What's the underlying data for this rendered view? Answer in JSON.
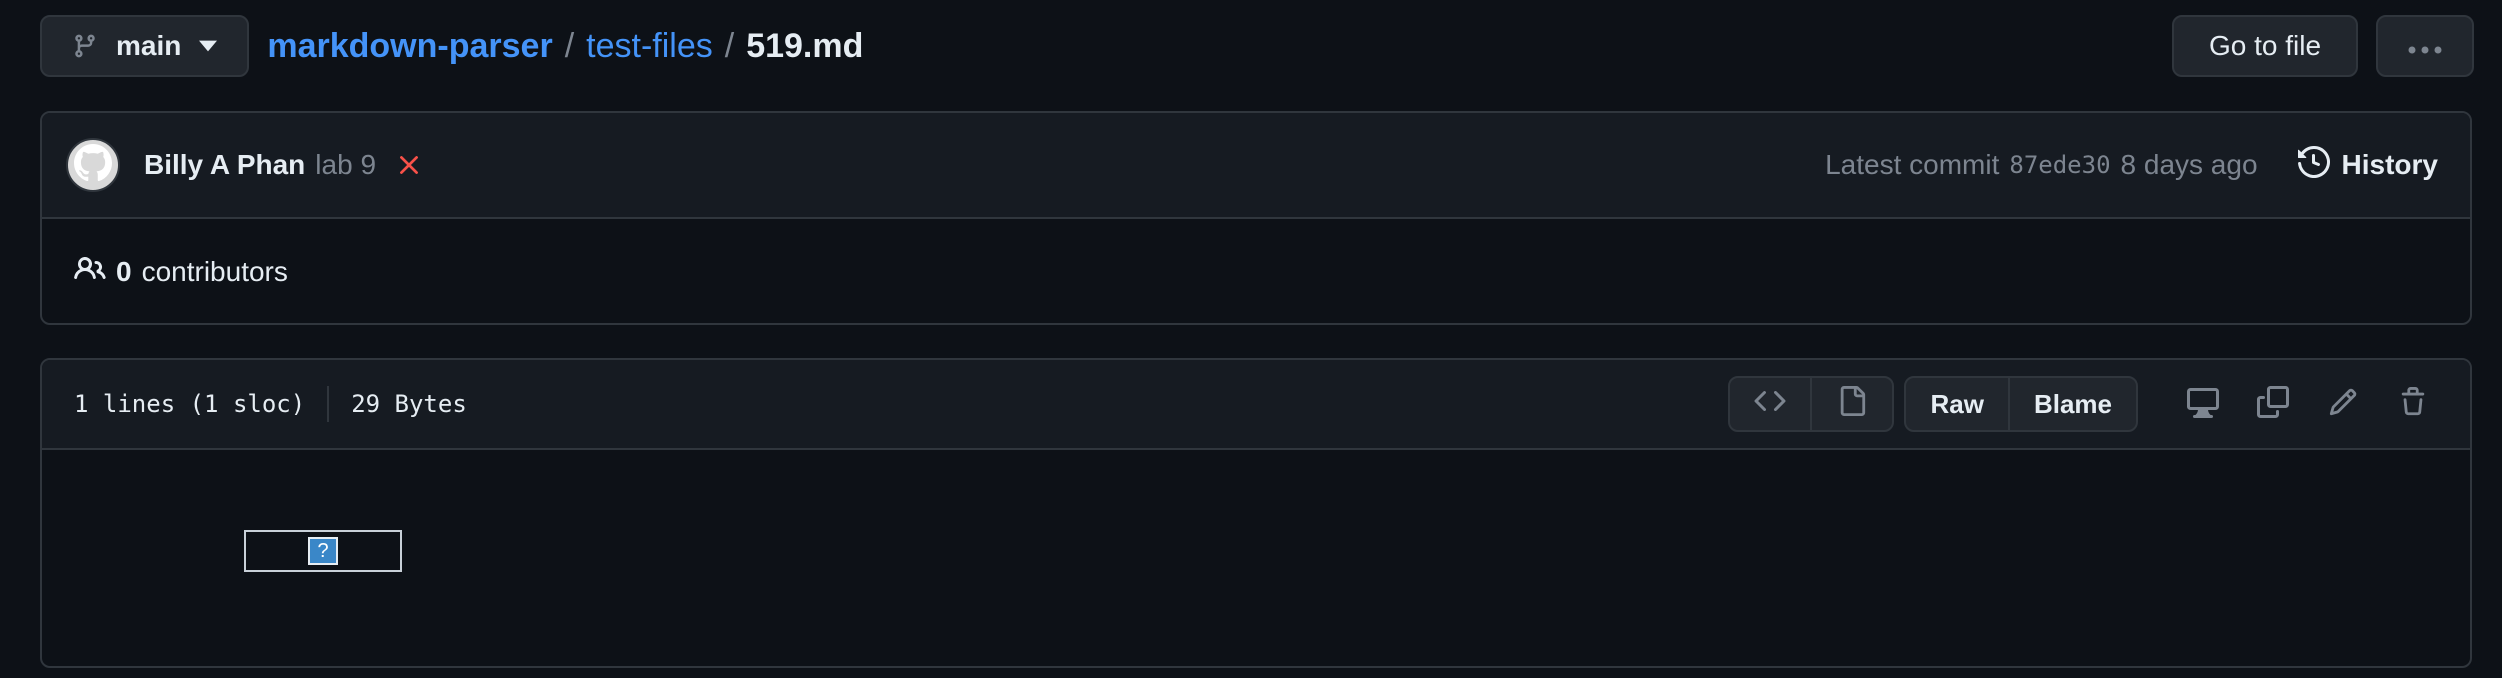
{
  "topbar": {
    "branch": "main",
    "breadcrumb": {
      "repo": "markdown-parser",
      "folder": "test-files",
      "file": "519.md",
      "separator": "/"
    },
    "goto_file_label": "Go to file"
  },
  "commit": {
    "author": "Billy A Phan",
    "message": "lab 9",
    "latest_label": "Latest commit",
    "sha": "87ede30",
    "age": "8 days ago",
    "history_label": "History",
    "status_color": "#f85149"
  },
  "contributors": {
    "count": "0",
    "label": "contributors"
  },
  "file": {
    "lines": "1 lines (1 sloc)",
    "size": "29 Bytes",
    "raw_label": "Raw",
    "blame_label": "Blame",
    "broken_image_glyph": "?"
  },
  "icons": {
    "branch": "git-branch-icon",
    "caret": "caret-down-icon",
    "more": "kebab-horizontal-icon",
    "avatar": "github-mark-icon",
    "status": "x-icon",
    "history": "history-icon",
    "people": "people-icon",
    "code": "code-icon",
    "file": "file-icon",
    "display": "display-icon",
    "copy": "copy-icon",
    "pencil": "pencil-icon",
    "trash": "trash-icon"
  },
  "colors": {
    "background": "#0d1117",
    "panel": "#161b22",
    "border": "#30363d",
    "link": "#4493f8",
    "muted": "#7d8590",
    "text": "#e6edf3"
  }
}
